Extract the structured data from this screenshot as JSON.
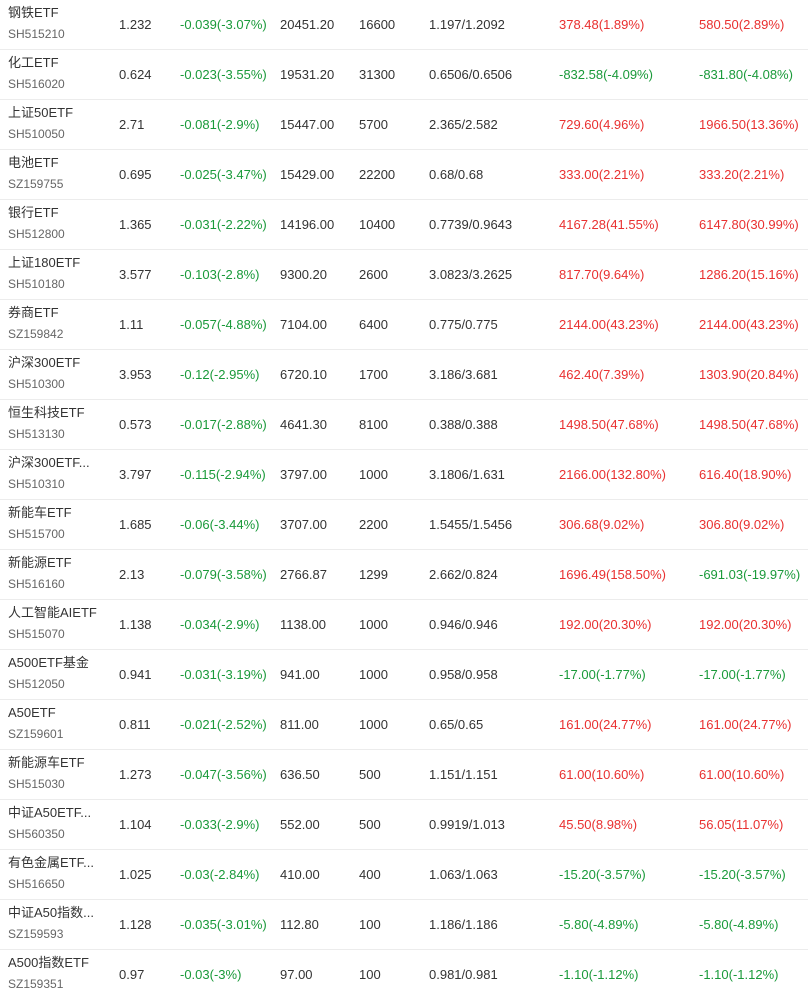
{
  "colors": {
    "up": "#e93030",
    "down": "#1a9a3a",
    "text": "#333333",
    "subtext": "#666666",
    "divider": "#ececec"
  },
  "rows": [
    {
      "name": "钢铁ETF",
      "code": "SH515210",
      "price": "1.232",
      "change": "-0.039(-3.07%)",
      "value": "20451.20",
      "qty": "16600",
      "cost": "1.197/1.2092",
      "pl_a": "378.48(1.89%)",
      "pl_b": "580.50(2.89%)"
    },
    {
      "name": "化工ETF",
      "code": "SH516020",
      "price": "0.624",
      "change": "-0.023(-3.55%)",
      "value": "19531.20",
      "qty": "31300",
      "cost": "0.6506/0.6506",
      "pl_a": "-832.58(-4.09%)",
      "pl_b": "-831.80(-4.08%)"
    },
    {
      "name": "上证50ETF",
      "code": "SH510050",
      "price": "2.71",
      "change": "-0.081(-2.9%)",
      "value": "15447.00",
      "qty": "5700",
      "cost": "2.365/2.582",
      "pl_a": "729.60(4.96%)",
      "pl_b": "1966.50(13.36%)"
    },
    {
      "name": "电池ETF",
      "code": "SZ159755",
      "price": "0.695",
      "change": "-0.025(-3.47%)",
      "value": "15429.00",
      "qty": "22200",
      "cost": "0.68/0.68",
      "pl_a": "333.00(2.21%)",
      "pl_b": "333.20(2.21%)"
    },
    {
      "name": "银行ETF",
      "code": "SH512800",
      "price": "1.365",
      "change": "-0.031(-2.22%)",
      "value": "14196.00",
      "qty": "10400",
      "cost": "0.7739/0.9643",
      "pl_a": "4167.28(41.55%)",
      "pl_b": "6147.80(30.99%)"
    },
    {
      "name": "上证180ETF",
      "code": "SH510180",
      "price": "3.577",
      "change": "-0.103(-2.8%)",
      "value": "9300.20",
      "qty": "2600",
      "cost": "3.0823/3.2625",
      "pl_a": "817.70(9.64%)",
      "pl_b": "1286.20(15.16%)"
    },
    {
      "name": "券商ETF",
      "code": "SZ159842",
      "price": "1.11",
      "change": "-0.057(-4.88%)",
      "value": "7104.00",
      "qty": "6400",
      "cost": "0.775/0.775",
      "pl_a": "2144.00(43.23%)",
      "pl_b": "2144.00(43.23%)"
    },
    {
      "name": "沪深300ETF",
      "code": "SH510300",
      "price": "3.953",
      "change": "-0.12(-2.95%)",
      "value": "6720.10",
      "qty": "1700",
      "cost": "3.186/3.681",
      "pl_a": "462.40(7.39%)",
      "pl_b": "1303.90(20.84%)"
    },
    {
      "name": "恒生科技ETF",
      "code": "SH513130",
      "price": "0.573",
      "change": "-0.017(-2.88%)",
      "value": "4641.30",
      "qty": "8100",
      "cost": "0.388/0.388",
      "pl_a": "1498.50(47.68%)",
      "pl_b": "1498.50(47.68%)"
    },
    {
      "name": "沪深300ETF...",
      "code": "SH510310",
      "price": "3.797",
      "change": "-0.115(-2.94%)",
      "value": "3797.00",
      "qty": "1000",
      "cost": "3.1806/1.631",
      "pl_a": "2166.00(132.80%)",
      "pl_b": "616.40(18.90%)"
    },
    {
      "name": "新能车ETF",
      "code": "SH515700",
      "price": "1.685",
      "change": "-0.06(-3.44%)",
      "value": "3707.00",
      "qty": "2200",
      "cost": "1.5455/1.5456",
      "pl_a": "306.68(9.02%)",
      "pl_b": "306.80(9.02%)"
    },
    {
      "name": "新能源ETF",
      "code": "SH516160",
      "price": "2.13",
      "change": "-0.079(-3.58%)",
      "value": "2766.87",
      "qty": "1299",
      "cost": "2.662/0.824",
      "pl_a": "1696.49(158.50%)",
      "pl_b": "-691.03(-19.97%)"
    },
    {
      "name": "人工智能AIETF",
      "code": "SH515070",
      "price": "1.138",
      "change": "-0.034(-2.9%)",
      "value": "1138.00",
      "qty": "1000",
      "cost": "0.946/0.946",
      "pl_a": "192.00(20.30%)",
      "pl_b": "192.00(20.30%)"
    },
    {
      "name": "A500ETF基金",
      "code": "SH512050",
      "price": "0.941",
      "change": "-0.031(-3.19%)",
      "value": "941.00",
      "qty": "1000",
      "cost": "0.958/0.958",
      "pl_a": "-17.00(-1.77%)",
      "pl_b": "-17.00(-1.77%)"
    },
    {
      "name": "A50ETF",
      "code": "SZ159601",
      "price": "0.811",
      "change": "-0.021(-2.52%)",
      "value": "811.00",
      "qty": "1000",
      "cost": "0.65/0.65",
      "pl_a": "161.00(24.77%)",
      "pl_b": "161.00(24.77%)"
    },
    {
      "name": "新能源车ETF",
      "code": "SH515030",
      "price": "1.273",
      "change": "-0.047(-3.56%)",
      "value": "636.50",
      "qty": "500",
      "cost": "1.151/1.151",
      "pl_a": "61.00(10.60%)",
      "pl_b": "61.00(10.60%)"
    },
    {
      "name": "中证A50ETF...",
      "code": "SH560350",
      "price": "1.104",
      "change": "-0.033(-2.9%)",
      "value": "552.00",
      "qty": "500",
      "cost": "0.9919/1.013",
      "pl_a": "45.50(8.98%)",
      "pl_b": "56.05(11.07%)"
    },
    {
      "name": "有色金属ETF...",
      "code": "SH516650",
      "price": "1.025",
      "change": "-0.03(-2.84%)",
      "value": "410.00",
      "qty": "400",
      "cost": "1.063/1.063",
      "pl_a": "-15.20(-3.57%)",
      "pl_b": "-15.20(-3.57%)"
    },
    {
      "name": "中证A50指数...",
      "code": "SZ159593",
      "price": "1.128",
      "change": "-0.035(-3.01%)",
      "value": "112.80",
      "qty": "100",
      "cost": "1.186/1.186",
      "pl_a": "-5.80(-4.89%)",
      "pl_b": "-5.80(-4.89%)"
    },
    {
      "name": "A500指数ETF",
      "code": "SZ159351",
      "price": "0.97",
      "change": "-0.03(-3%)",
      "value": "97.00",
      "qty": "100",
      "cost": "0.981/0.981",
      "pl_a": "-1.10(-1.12%)",
      "pl_b": "-1.10(-1.12%)"
    }
  ]
}
